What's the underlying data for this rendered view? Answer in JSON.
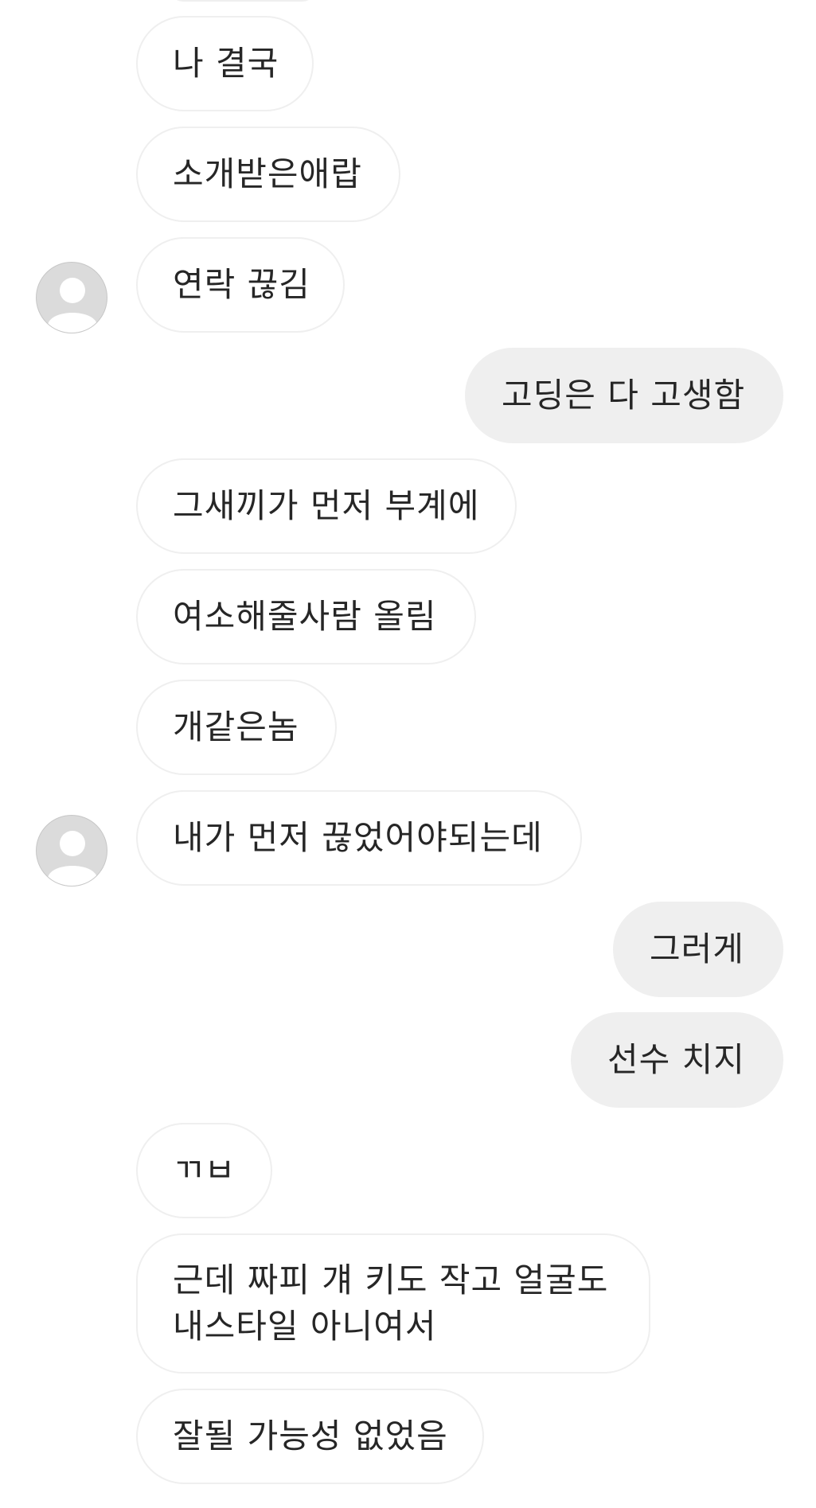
{
  "thread": {
    "messages": [
      {
        "id": "m1",
        "sender": "other",
        "text": "나 결국"
      },
      {
        "id": "m2",
        "sender": "other",
        "text": "소개받은애랍"
      },
      {
        "id": "m3",
        "sender": "other",
        "text": "연락 끊김",
        "avatar": true
      },
      {
        "id": "m4",
        "sender": "me",
        "text": "고딩은 다 고생함"
      },
      {
        "id": "m5",
        "sender": "other",
        "text": "그새끼가 먼저 부계에"
      },
      {
        "id": "m6",
        "sender": "other",
        "text": "여소해줄사람 올림"
      },
      {
        "id": "m7",
        "sender": "other",
        "text": "개같은놈"
      },
      {
        "id": "m8",
        "sender": "other",
        "text": "내가 먼저 끊었어야되는데",
        "avatar": true
      },
      {
        "id": "m9",
        "sender": "me",
        "text": "그러게"
      },
      {
        "id": "m10",
        "sender": "me",
        "text": "선수 치지"
      },
      {
        "id": "m11",
        "sender": "other",
        "text": "ㄲㅂ"
      },
      {
        "id": "m12",
        "sender": "other",
        "lines": [
          "근데 짜피 걔 키도 작고 얼굴도",
          "내스타일 아니여서"
        ]
      },
      {
        "id": "m13",
        "sender": "other",
        "text": "잘될 가능성 없었음"
      }
    ]
  },
  "colors": {
    "incoming_bg": "#ffffff",
    "incoming_border": "#efefef",
    "outgoing_bg": "#efefef",
    "text": "#262626",
    "avatar_bg": "#dbdbdb",
    "avatar_figure": "#ffffff"
  },
  "icons": {
    "avatar": "default-profile-icon"
  }
}
